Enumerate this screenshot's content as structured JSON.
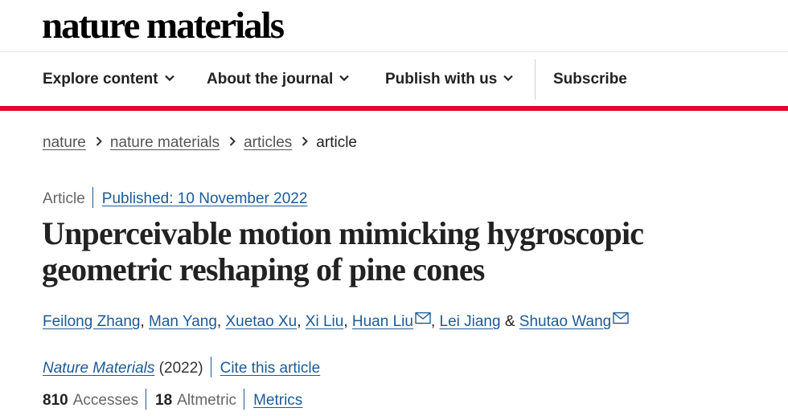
{
  "site": {
    "logo": "nature materials"
  },
  "nav": {
    "items": [
      {
        "label": "Explore content"
      },
      {
        "label": "About the journal"
      },
      {
        "label": "Publish with us"
      }
    ],
    "subscribe": "Subscribe"
  },
  "breadcrumb": [
    "nature",
    "nature materials",
    "articles",
    "article"
  ],
  "article": {
    "type": "Article",
    "published": "Published: 10 November 2022",
    "title_lines": [
      "Unperceivable motion mimicking hygroscopic",
      "geometric reshaping of pine cones"
    ],
    "authors": [
      "Feilong Zhang",
      "Man Yang",
      "Xuetao Xu",
      "Xi Liu",
      "Huan Liu",
      "Lei Jiang",
      "Shutao Wang"
    ],
    "journal": "Nature Materials",
    "year": "(2022)",
    "cite": "Cite this article",
    "accesses_count": "810",
    "accesses_label": "Accesses",
    "altmetric_count": "18",
    "altmetric_label": "Altmetric",
    "metrics_link": "Metrics"
  },
  "colors": {
    "accent_red": "#e0002a",
    "link": "#1e5a96"
  }
}
